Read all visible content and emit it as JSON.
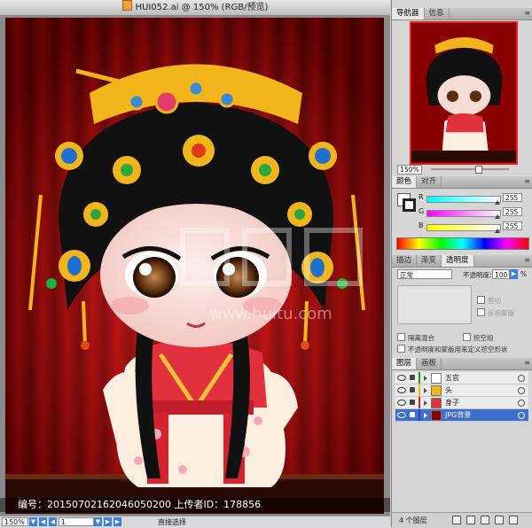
{
  "window": {
    "title": "HUI052.ai @ 150% (RGB/预览)"
  },
  "statusbar": {
    "zoom": "150%",
    "page": "1",
    "status": "直接选择"
  },
  "caption": "编号：20150702162046050200 上传者ID：178856",
  "watermark": {
    "text": "汇图网",
    "url": "www.huitu.com"
  },
  "navigator": {
    "tabs": [
      {
        "label": "导航器",
        "active": true
      },
      {
        "label": "信息",
        "active": false
      }
    ],
    "zoom": "150%"
  },
  "color_panel": {
    "tabs": [
      {
        "label": "颜色",
        "active": true
      },
      {
        "label": "对齐",
        "active": false
      }
    ],
    "channels": [
      {
        "label": "R",
        "value": "255",
        "gradient": "linear-gradient(to right,#00ffff,#ffffff)"
      },
      {
        "label": "G",
        "value": "255",
        "gradient": "linear-gradient(to right,#ff00ff,#ffffff)"
      },
      {
        "label": "B",
        "value": "255",
        "gradient": "linear-gradient(to right,#ffff00,#ffffff)"
      }
    ]
  },
  "transparency_panel": {
    "tabs": [
      {
        "label": "描边",
        "active": false
      },
      {
        "label": "渐变",
        "active": false
      },
      {
        "label": "透明度",
        "active": true
      }
    ],
    "blend_mode": "正常",
    "opacity_label": "不透明度:",
    "opacity": "100",
    "opacity_unit": "%",
    "options": [
      {
        "label": "剪切",
        "dim": true
      },
      {
        "label": "反相蒙版",
        "dim": true
      }
    ],
    "checks": [
      {
        "label": "隔离混合"
      },
      {
        "label": "挖空组"
      },
      {
        "label": "不透明度和蒙版用来定义挖空形状"
      }
    ]
  },
  "layers_panel": {
    "tabs": [
      {
        "label": "图层",
        "active": true
      },
      {
        "label": "画板",
        "active": false
      }
    ],
    "layers": [
      {
        "name": "五官",
        "color": "#2e8b2e",
        "selected": false
      },
      {
        "name": "头",
        "color": "#e0c000",
        "selected": false
      },
      {
        "name": "身子",
        "color": "#d02020",
        "selected": false
      },
      {
        "name": "JPG背景",
        "color": "#2040d0",
        "selected": true
      }
    ],
    "count": "4 个图层"
  },
  "colors": {
    "curtain": "#a40000",
    "curtain_dark": "#5a0000",
    "gold": "#f2b51c",
    "hair": "#111111",
    "robe": "#e0303a",
    "skin": "#f7dcd6"
  }
}
